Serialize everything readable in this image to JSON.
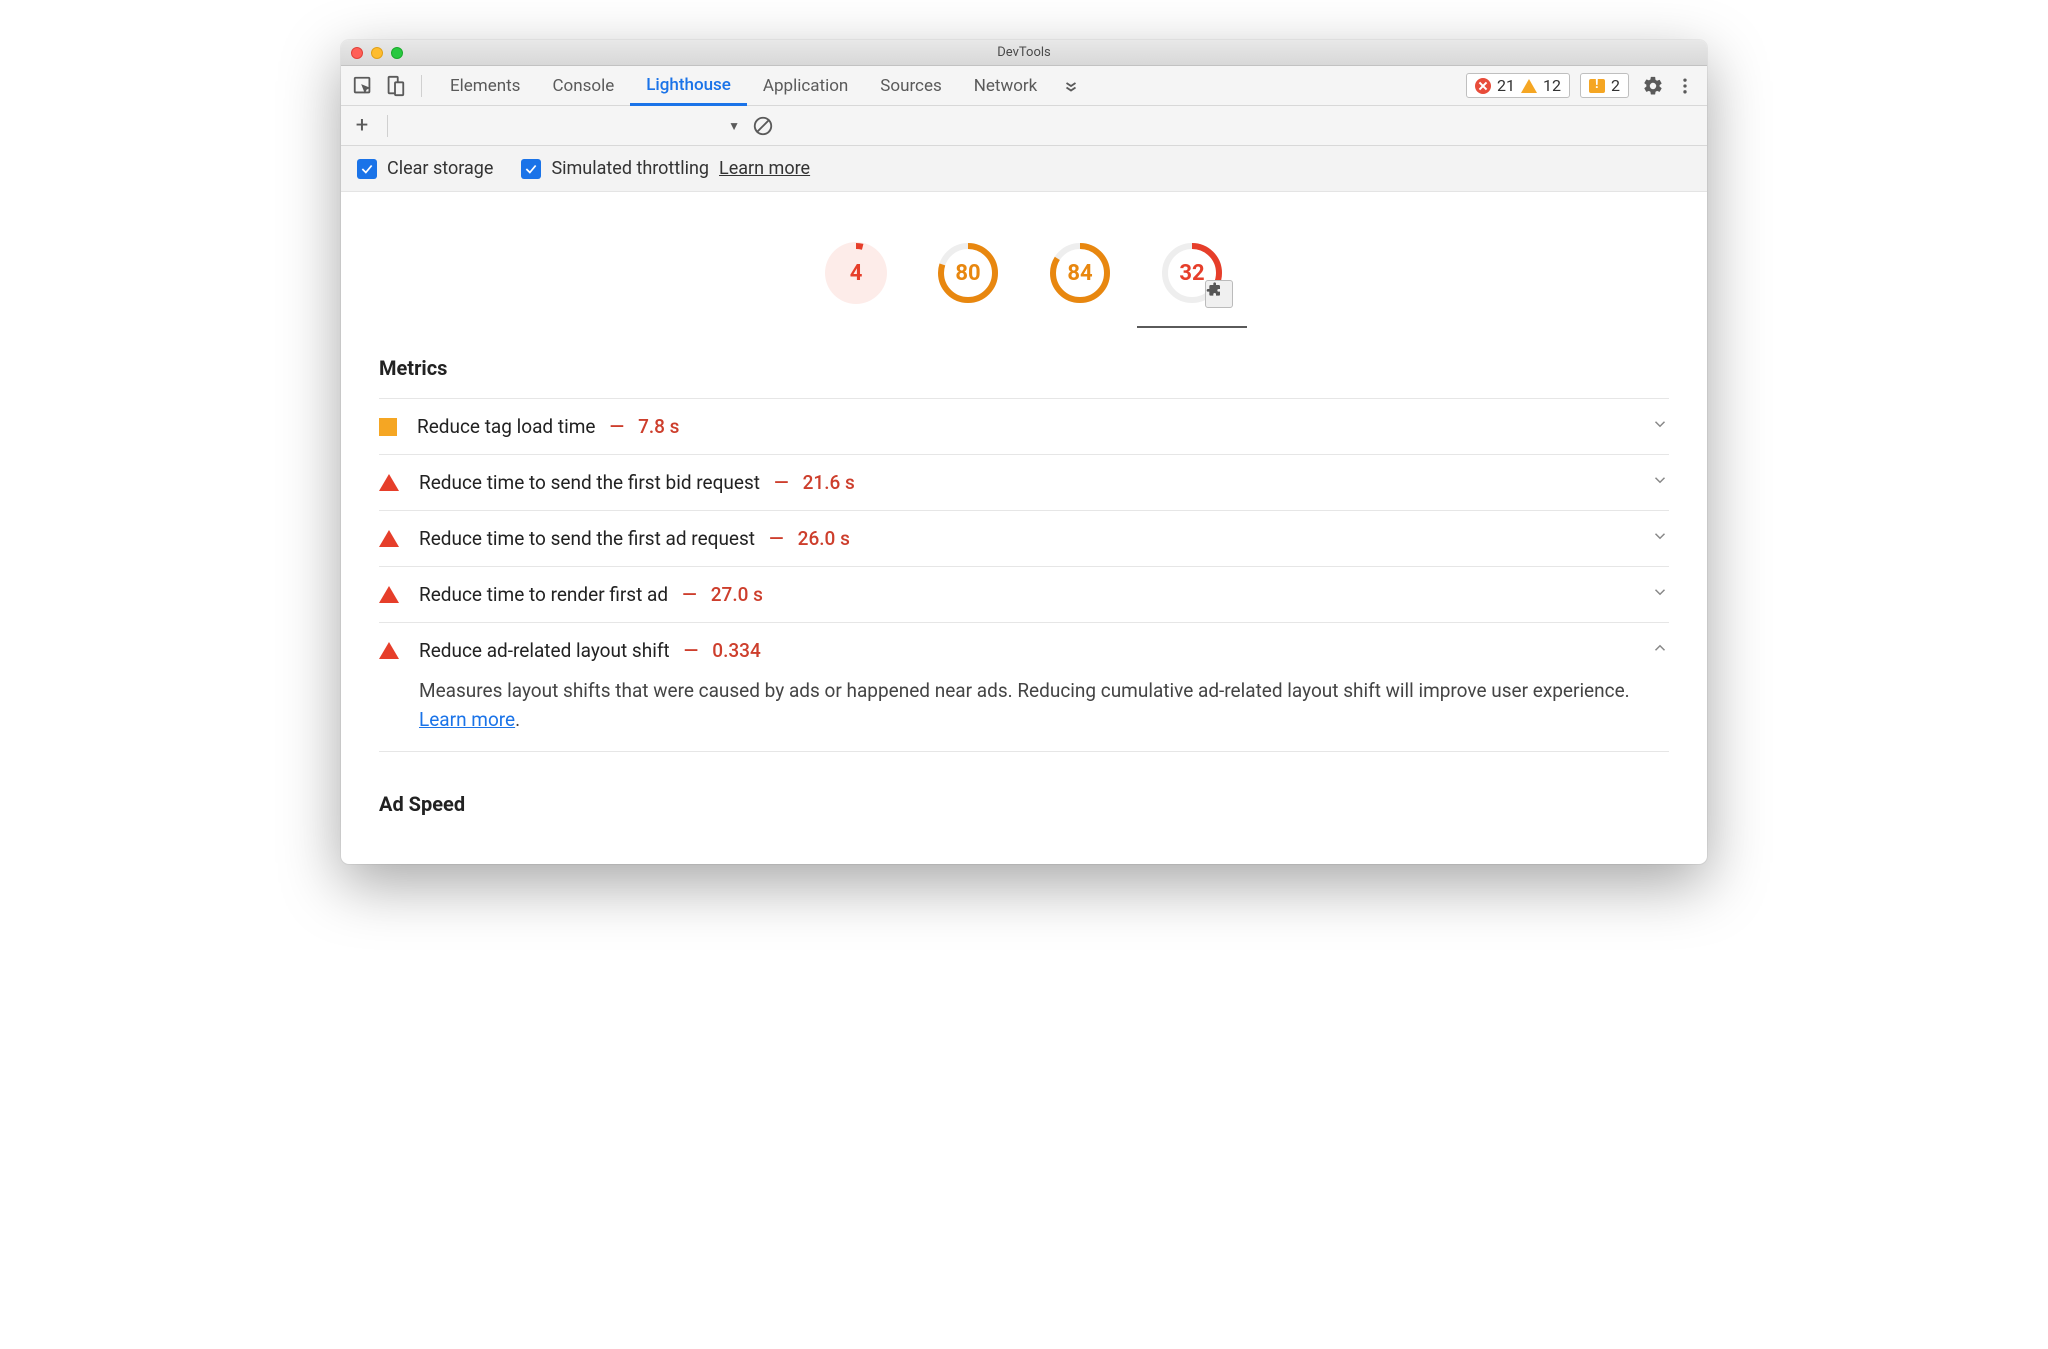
{
  "window": {
    "title": "DevTools"
  },
  "tabs": {
    "items": [
      "Elements",
      "Console",
      "Lighthouse",
      "Application",
      "Sources",
      "Network"
    ],
    "active_index": 2
  },
  "statusbar": {
    "errors": "21",
    "warnings": "12",
    "messages": "2"
  },
  "settings": {
    "clear_storage_label": "Clear storage",
    "simulated_throttling_label": "Simulated throttling",
    "learn_more_label": "Learn more"
  },
  "gauges": [
    {
      "value": "4",
      "style": "red-fill",
      "pct": 4,
      "selected": false
    },
    {
      "value": "80",
      "style": "orange",
      "pct": 80,
      "selected": false
    },
    {
      "value": "84",
      "style": "orange",
      "pct": 84,
      "selected": false
    },
    {
      "value": "32",
      "style": "red-ring",
      "pct": 32,
      "selected": true
    }
  ],
  "metrics_title": "Metrics",
  "metrics": [
    {
      "icon": "sq",
      "name": "Reduce tag load time",
      "value": "7.8 s",
      "expanded": false
    },
    {
      "icon": "tri",
      "name": "Reduce time to send the first bid request",
      "value": "21.6 s",
      "expanded": false
    },
    {
      "icon": "tri",
      "name": "Reduce time to send the first ad request",
      "value": "26.0 s",
      "expanded": false
    },
    {
      "icon": "tri",
      "name": "Reduce time to render first ad",
      "value": "27.0 s",
      "expanded": false
    },
    {
      "icon": "tri",
      "name": "Reduce ad-related layout shift",
      "value": "0.334",
      "expanded": true,
      "description_pre": "Measures layout shifts that were caused by ads or happened near ads. Reducing cumulative ad-related layout shift will improve user experience. ",
      "description_link": "Learn more",
      "description_post": "."
    }
  ],
  "ad_speed_title": "Ad Speed"
}
